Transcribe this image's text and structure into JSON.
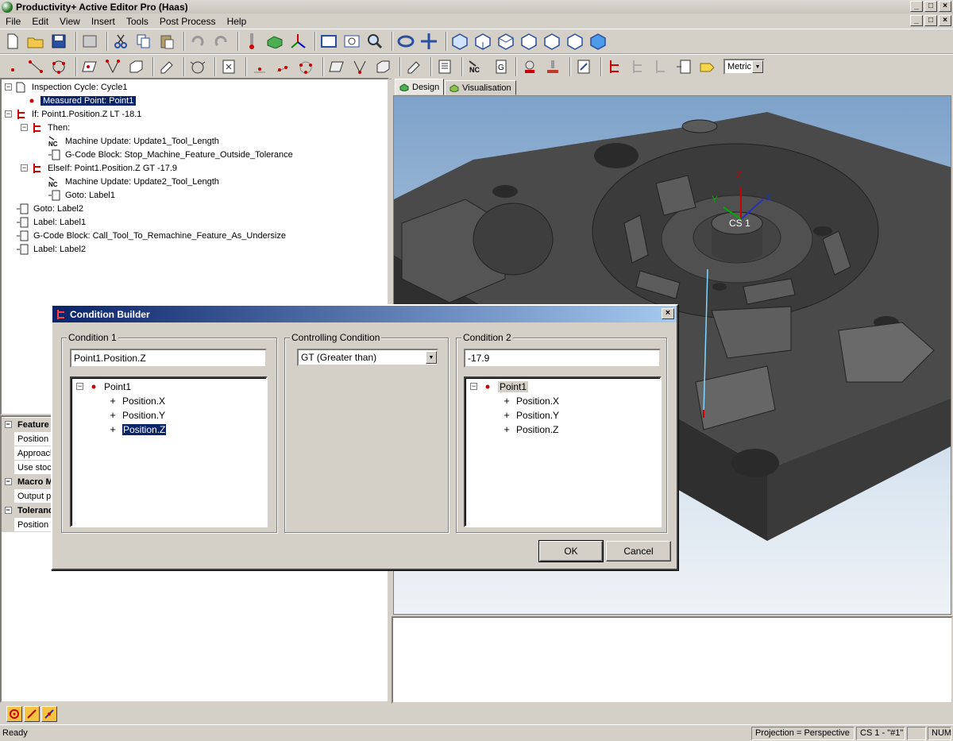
{
  "window": {
    "title": "Productivity+ Active Editor Pro (Haas)",
    "controls": [
      "_",
      "□",
      "×"
    ]
  },
  "menu": [
    "File",
    "Edit",
    "View",
    "Insert",
    "Tools",
    "Post Process",
    "Help"
  ],
  "toolbar": {
    "units_value": "Metric"
  },
  "tree": {
    "items": [
      {
        "label": "Inspection Cycle: Cycle1"
      },
      {
        "label": "Measured Point: Point1"
      },
      {
        "label": "If: Point1.Position.Z LT -18.1"
      },
      {
        "label": "Then:"
      },
      {
        "label": "Machine Update: Update1_Tool_Length"
      },
      {
        "label": "G-Code Block: Stop_Machine_Feature_Outside_Tolerance"
      },
      {
        "label": "ElseIf: Point1.Position.Z GT -17.9"
      },
      {
        "label": "Machine Update: Update2_Tool_Length"
      },
      {
        "label": "Goto: Label1"
      },
      {
        "label": "Goto: Label2"
      },
      {
        "label": "Label: Label1"
      },
      {
        "label": "G-Code Block: Call_Tool_To_Remachine_Feature_As_Undersize"
      },
      {
        "label": "Label: Label2"
      }
    ]
  },
  "properties": {
    "rows": [
      {
        "label": "Feature"
      },
      {
        "label": "Position (F"
      },
      {
        "label": "Approach"
      },
      {
        "label": "Use stock"
      },
      {
        "label": "Macro M"
      },
      {
        "label": "Output pc"
      },
      {
        "label": "Toleranc"
      },
      {
        "label": "Position T"
      }
    ]
  },
  "viewport": {
    "tabs": [
      {
        "label": "Design"
      },
      {
        "label": "Visualisation"
      }
    ],
    "axis_labels": {
      "x": "X",
      "y": "Y",
      "z": "Z",
      "cs": "CS 1"
    }
  },
  "dialog": {
    "title": "Condition Builder",
    "condition1": {
      "label": "Condition 1",
      "value": "Point1.Position.Z",
      "tree_root": "Point1",
      "children": [
        "Position.X",
        "Position.Y",
        "Position.Z"
      ]
    },
    "controlling": {
      "label": "Controlling Condition",
      "value": "GT (Greater than)"
    },
    "condition2": {
      "label": "Condition 2",
      "value": "-17.9",
      "tree_root": "Point1",
      "children": [
        "Position.X",
        "Position.Y",
        "Position.Z"
      ]
    },
    "ok_label": "OK",
    "cancel_label": "Cancel"
  },
  "statusbar": {
    "message": "Ready",
    "projection": "Projection = Perspective",
    "cs": "CS 1 - \"#1\"",
    "num": "NUM"
  }
}
